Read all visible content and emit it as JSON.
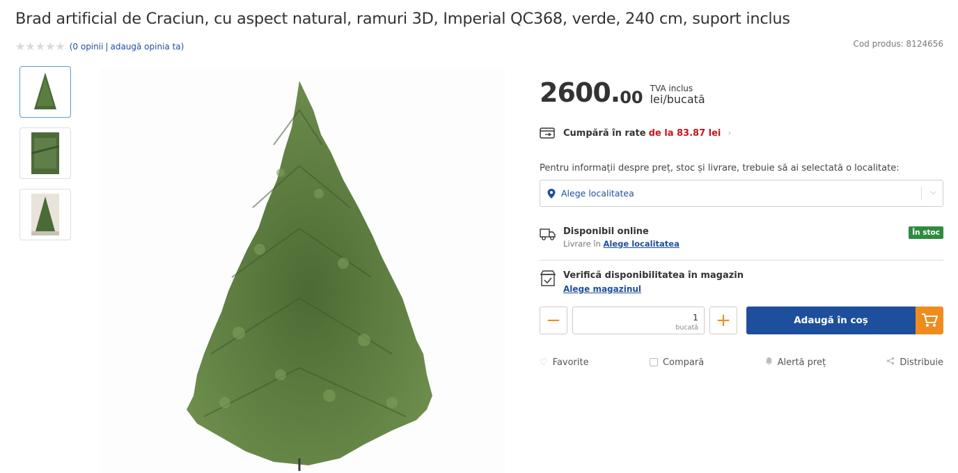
{
  "product": {
    "title": "Brad artificial de Craciun, cu aspect natural, ramuri 3D, Imperial QC368, verde, 240 cm, suport inclus",
    "code": "Cod produs: 8124656"
  },
  "rating": {
    "stars": "★★★★★",
    "reviews_link": "(0 opinii",
    "separator": "|",
    "add_review_link": "adaugă opinia ta)"
  },
  "gallery": {
    "thumbnails": [
      "thumb-tree-full",
      "thumb-tree-branch",
      "thumb-tree-room"
    ],
    "active_index": 0
  },
  "price": {
    "integer": "2600.",
    "decimals": "00",
    "tva": "TVA inclus",
    "unit": "lei/bucată"
  },
  "installments": {
    "label": "Cumpără în rate",
    "amount": "de la 83.87 lei",
    "chevron": "›"
  },
  "location": {
    "info": "Pentru informații despre preț, stoc și livrare, trebuie să ai selectată o localitate:",
    "select_label": "Alege localitatea"
  },
  "online": {
    "heading": "Disponibil online",
    "delivery_prefix": "Livrare în",
    "delivery_link": "Alege localitatea",
    "stock_badge": "În stoc"
  },
  "store": {
    "heading": "Verifică disponibilitatea în magazin",
    "link": "Alege magazinul"
  },
  "quantity": {
    "minus": "−",
    "plus": "+",
    "value": "1",
    "unit": "bucată"
  },
  "cart": {
    "label": "Adaugă în coș"
  },
  "actions": {
    "favorite": "Favorite",
    "compare": "Compară",
    "price_alert": "Alertă preț",
    "share": "Distribuie"
  },
  "colors": {
    "primary_blue": "#1e4f9c",
    "accent_orange": "#f08c1e",
    "stock_green": "#2e8b3f",
    "installment_red": "#c4161c"
  }
}
